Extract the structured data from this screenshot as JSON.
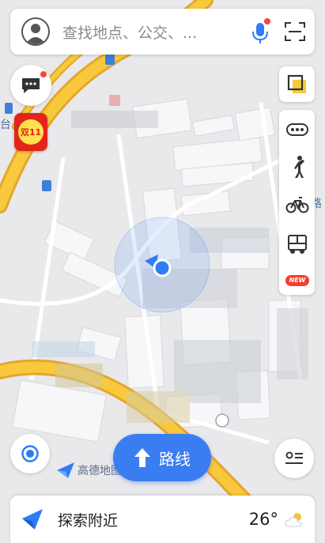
{
  "search": {
    "placeholder": "查找地点、公交、..."
  },
  "map": {
    "brand_label": "高德地图",
    "colors": {
      "road_major": "#f5c23a",
      "road_border": "#e9a92a",
      "building": "#f6f6f8",
      "building_edge": "#d9d9de",
      "ground": "#e9e9ec",
      "location": "#2f7cf6"
    }
  },
  "route": {
    "label": "路线"
  },
  "promo": {
    "label": "双11"
  },
  "tools": [
    {
      "icon": "bus-dots-icon"
    },
    {
      "icon": "walking-person-icon"
    },
    {
      "icon": "bicycle-icon"
    },
    {
      "icon": "bus-icon",
      "badge": "NEW"
    }
  ],
  "bottom": {
    "explore_label": "探索附近",
    "temperature": "26°",
    "weather_icon": "partly-cloudy-icon"
  }
}
